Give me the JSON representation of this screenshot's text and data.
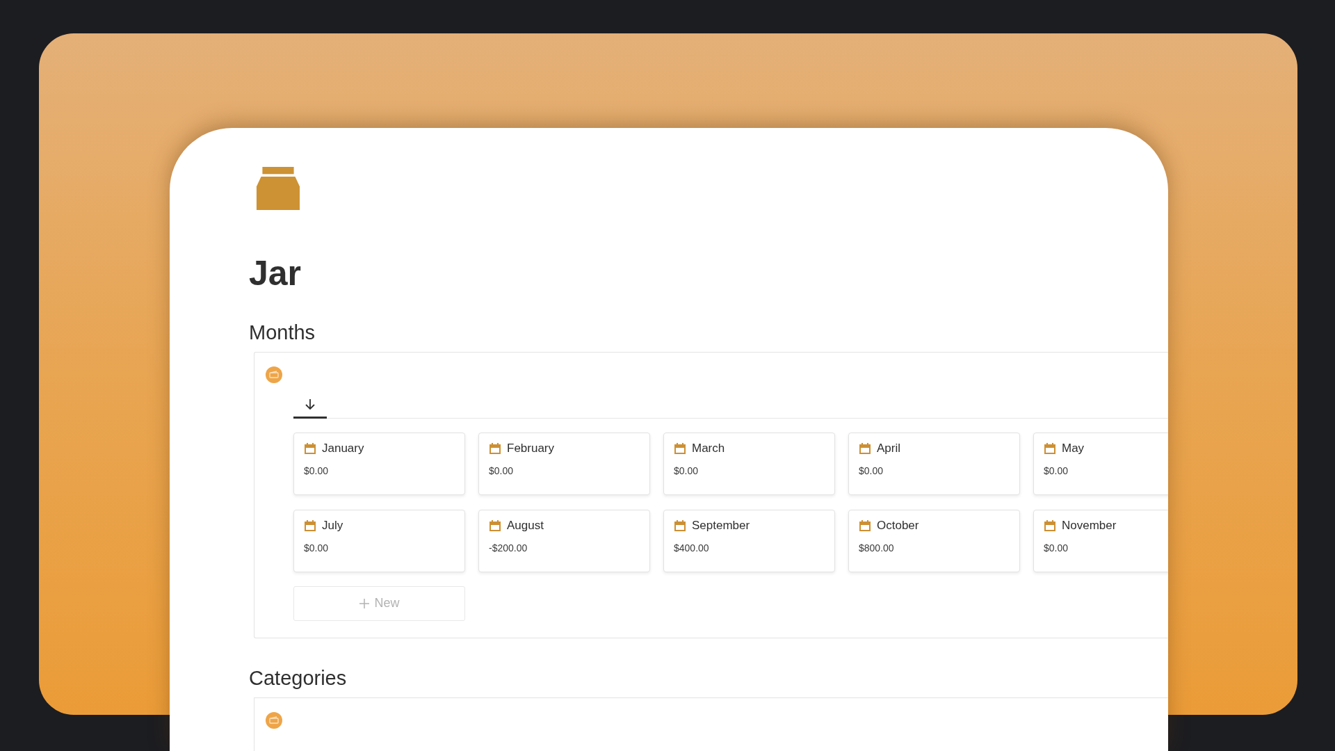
{
  "page": {
    "title": "Jar"
  },
  "sections": [
    {
      "heading": "Months",
      "view_tabs": [
        {
          "selected": true
        }
      ],
      "cards": [
        {
          "name": "January",
          "amount": "$0.00"
        },
        {
          "name": "February",
          "amount": "$0.00"
        },
        {
          "name": "March",
          "amount": "$0.00"
        },
        {
          "name": "April",
          "amount": "$0.00"
        },
        {
          "name": "May",
          "amount": "$0.00"
        },
        {
          "name": "July",
          "amount": "$0.00"
        },
        {
          "name": "August",
          "amount": "-$200.00"
        },
        {
          "name": "September",
          "amount": "$400.00"
        },
        {
          "name": "October",
          "amount": "$800.00"
        },
        {
          "name": "November",
          "amount": "$0.00"
        }
      ],
      "new_button": "New"
    },
    {
      "heading": "Categories"
    }
  ]
}
